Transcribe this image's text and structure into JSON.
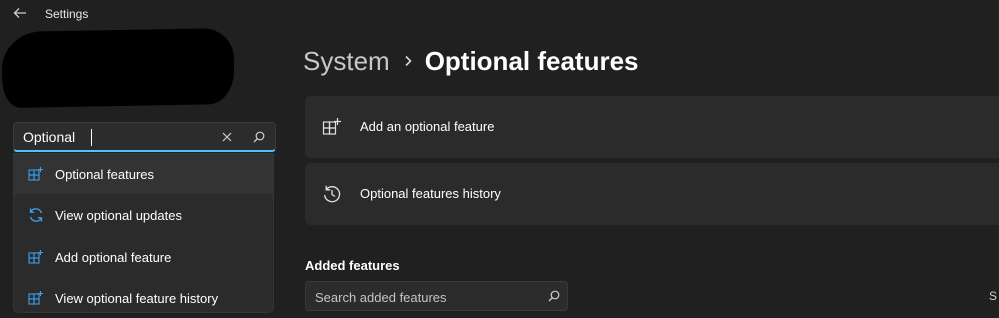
{
  "window": {
    "title": "Settings"
  },
  "icons": {
    "back": "arrow-left-icon",
    "clear": "close-icon",
    "search": "search-icon",
    "chevron": "chevron-right-icon",
    "grid_add": "grid-add-icon",
    "refresh": "refresh-icon",
    "history": "history-icon"
  },
  "colors": {
    "accent": "#4cc2ff",
    "background": "#202020",
    "card": "#2b2b2b",
    "suggestion_icon": "#3aa0f0"
  },
  "search": {
    "value": "Optional"
  },
  "suggestions": [
    {
      "label": "Optional features",
      "icon": "grid-add-icon"
    },
    {
      "label": "View optional updates",
      "icon": "refresh-icon"
    },
    {
      "label": "Add optional feature",
      "icon": "grid-add-icon"
    },
    {
      "label": "View optional feature history",
      "icon": "grid-add-icon"
    }
  ],
  "breadcrumb": {
    "parent": "System",
    "current": "Optional features"
  },
  "cards": [
    {
      "label": "Add an optional feature",
      "icon": "grid-add-icon"
    },
    {
      "label": "Optional features history",
      "icon": "history-icon"
    }
  ],
  "added_features": {
    "heading": "Added features",
    "search_placeholder": "Search added features",
    "sort_partial": "S"
  }
}
